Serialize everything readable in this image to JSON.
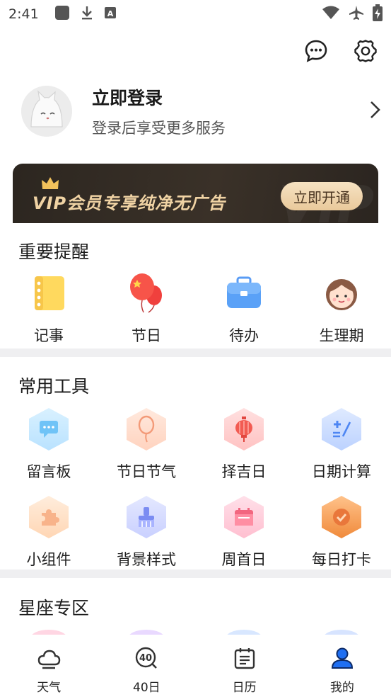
{
  "status_bar": {
    "time": "2:41"
  },
  "profile": {
    "title": "立即登录",
    "subtitle": "登录后享受更多服务"
  },
  "vip": {
    "text": "VIP会员专享纯净无广告",
    "button_label": "立即开通",
    "watermark": "VIP"
  },
  "reminders": {
    "title": "重要提醒",
    "items": [
      {
        "label": "记事",
        "icon": "notebook-icon"
      },
      {
        "label": "节日",
        "icon": "balloons-icon"
      },
      {
        "label": "待办",
        "icon": "briefcase-icon"
      },
      {
        "label": "生理期",
        "icon": "girl-face-icon"
      }
    ]
  },
  "tools": {
    "title": "常用工具",
    "items": [
      {
        "label": "留言板",
        "icon": "message-board-icon"
      },
      {
        "label": "节日节气",
        "icon": "balloon-icon"
      },
      {
        "label": "择吉日",
        "icon": "lantern-icon"
      },
      {
        "label": "日期计算",
        "icon": "calculator-icon"
      },
      {
        "label": "小组件",
        "icon": "puzzle-icon"
      },
      {
        "label": "背景样式",
        "icon": "brush-icon"
      },
      {
        "label": "周首日",
        "icon": "calendar-icon"
      },
      {
        "label": "每日打卡",
        "icon": "check-icon"
      }
    ]
  },
  "zodiac": {
    "title": "星座专区"
  },
  "bottom_nav": [
    {
      "label": "天气",
      "icon": "cloud-icon"
    },
    {
      "label": "40日",
      "icon": "forty-day-icon"
    },
    {
      "label": "日历",
      "icon": "calendar-icon"
    },
    {
      "label": "我的",
      "icon": "user-icon",
      "active": true
    }
  ],
  "colors": {
    "accent_blue": "#1f6ff2",
    "vip_gold": "#f0d3a4",
    "divider": "#efeff1"
  }
}
